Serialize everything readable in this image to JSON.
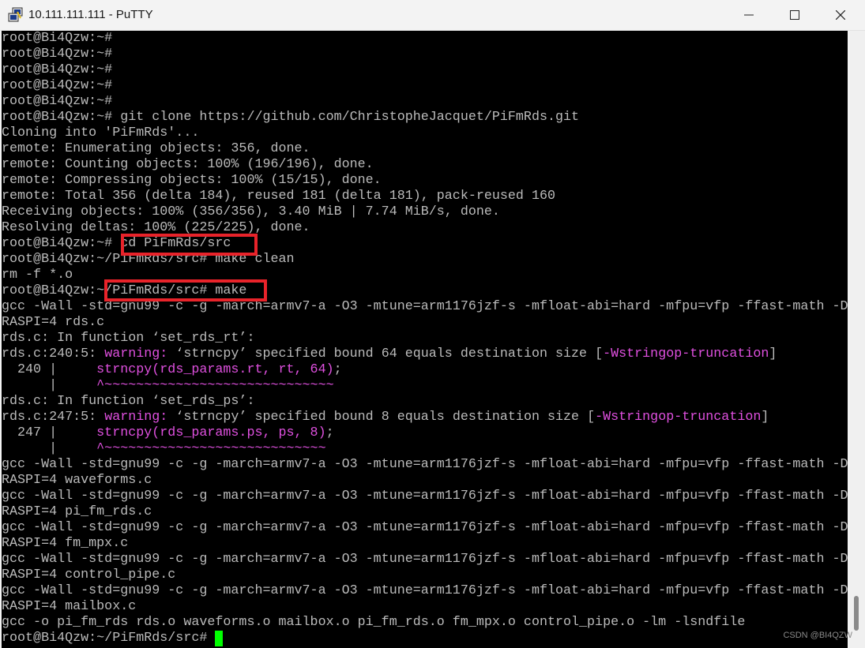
{
  "window": {
    "title": "10.111.111.111 - PuTTY",
    "app_icon": "putty-icon",
    "controls": {
      "minimize": "minimize-icon",
      "maximize": "maximize-icon",
      "close": "close-icon"
    }
  },
  "colors": {
    "terminal_bg": "#000000",
    "text": "#bbbbbb",
    "warning": "#e050e0",
    "cursor": "#00ff00",
    "highlight": "#e8232a"
  },
  "terminal": {
    "lines": [
      [
        {
          "t": "root@Bi4Qzw:~#"
        }
      ],
      [
        {
          "t": "root@Bi4Qzw:~#"
        }
      ],
      [
        {
          "t": "root@Bi4Qzw:~#"
        }
      ],
      [
        {
          "t": "root@Bi4Qzw:~#"
        }
      ],
      [
        {
          "t": "root@Bi4Qzw:~#"
        }
      ],
      [
        {
          "t": "root@Bi4Qzw:~# git clone https://github.com/ChristopheJacquet/PiFmRds.git"
        }
      ],
      [
        {
          "t": "Cloning into 'PiFmRds'..."
        }
      ],
      [
        {
          "t": "remote: Enumerating objects: 356, done."
        }
      ],
      [
        {
          "t": "remote: Counting objects: 100% (196/196), done."
        }
      ],
      [
        {
          "t": "remote: Compressing objects: 100% (15/15), done."
        }
      ],
      [
        {
          "t": "remote: Total 356 (delta 184), reused 181 (delta 181), pack-reused 160"
        }
      ],
      [
        {
          "t": "Receiving objects: 100% (356/356), 3.40 MiB | 7.74 MiB/s, done."
        }
      ],
      [
        {
          "t": "Resolving deltas: 100% (225/225), done."
        }
      ],
      [
        {
          "t": "root@Bi4Qzw:~# cd PiFmRds/src"
        }
      ],
      [
        {
          "t": "root@Bi4Qzw:~/PiFmRds/src# make clean"
        }
      ],
      [
        {
          "t": "rm -f *.o"
        }
      ],
      [
        {
          "t": "root@Bi4Qzw:~/PiFmRds/src# make"
        }
      ],
      [
        {
          "t": "gcc -Wall -std=gnu99 -c -g -march=armv7-a -O3 -mtune=arm1176jzf-s -mfloat-abi=hard -mfpu=vfp -ffast-math -D"
        }
      ],
      [
        {
          "t": "RASPI=4 rds.c"
        }
      ],
      [
        {
          "t": "rds.c: In function ‘set_rds_rt’:"
        }
      ],
      [
        {
          "t": "rds.c:240:5: "
        },
        {
          "t": "warning: ",
          "c": "warn"
        },
        {
          "t": "‘strncpy’ specified bound 64 equals destination size ["
        },
        {
          "t": "-Wstringop-truncation",
          "c": "warn"
        },
        {
          "t": "]"
        }
      ],
      [
        {
          "t": "  240 |     "
        },
        {
          "t": "strncpy(rds_params.rt, rt, 64)",
          "c": "warn"
        },
        {
          "t": ";"
        }
      ],
      [
        {
          "t": "      |     "
        },
        {
          "t": "^~~~~~~~~~~~~~~~~~~~~~~~~~~~~~",
          "c": "warn"
        }
      ],
      [
        {
          "t": "rds.c: In function ‘set_rds_ps’:"
        }
      ],
      [
        {
          "t": "rds.c:247:5: "
        },
        {
          "t": "warning: ",
          "c": "warn"
        },
        {
          "t": "‘strncpy’ specified bound 8 equals destination size ["
        },
        {
          "t": "-Wstringop-truncation",
          "c": "warn"
        },
        {
          "t": "]"
        }
      ],
      [
        {
          "t": "  247 |     "
        },
        {
          "t": "strncpy(rds_params.ps, ps, 8)",
          "c": "warn"
        },
        {
          "t": ";"
        }
      ],
      [
        {
          "t": "      |     "
        },
        {
          "t": "^~~~~~~~~~~~~~~~~~~~~~~~~~~~~",
          "c": "warn"
        }
      ],
      [
        {
          "t": "gcc -Wall -std=gnu99 -c -g -march=armv7-a -O3 -mtune=arm1176jzf-s -mfloat-abi=hard -mfpu=vfp -ffast-math -D"
        }
      ],
      [
        {
          "t": "RASPI=4 waveforms.c"
        }
      ],
      [
        {
          "t": "gcc -Wall -std=gnu99 -c -g -march=armv7-a -O3 -mtune=arm1176jzf-s -mfloat-abi=hard -mfpu=vfp -ffast-math -D"
        }
      ],
      [
        {
          "t": "RASPI=4 pi_fm_rds.c"
        }
      ],
      [
        {
          "t": "gcc -Wall -std=gnu99 -c -g -march=armv7-a -O3 -mtune=arm1176jzf-s -mfloat-abi=hard -mfpu=vfp -ffast-math -D"
        }
      ],
      [
        {
          "t": "RASPI=4 fm_mpx.c"
        }
      ],
      [
        {
          "t": "gcc -Wall -std=gnu99 -c -g -march=armv7-a -O3 -mtune=arm1176jzf-s -mfloat-abi=hard -mfpu=vfp -ffast-math -D"
        }
      ],
      [
        {
          "t": "RASPI=4 control_pipe.c"
        }
      ],
      [
        {
          "t": "gcc -Wall -std=gnu99 -c -g -march=armv7-a -O3 -mtune=arm1176jzf-s -mfloat-abi=hard -mfpu=vfp -ffast-math -D"
        }
      ],
      [
        {
          "t": "RASPI=4 mailbox.c"
        }
      ],
      [
        {
          "t": "gcc -o pi_fm_rds rds.o waveforms.o mailbox.o pi_fm_rds.o fm_mpx.o control_pipe.o -lm -lsndfile"
        }
      ],
      [
        {
          "t": "root@Bi4Qzw:~/PiFmRds/src# "
        }
      ]
    ]
  },
  "watermark": "CSDN @BI4QZW"
}
